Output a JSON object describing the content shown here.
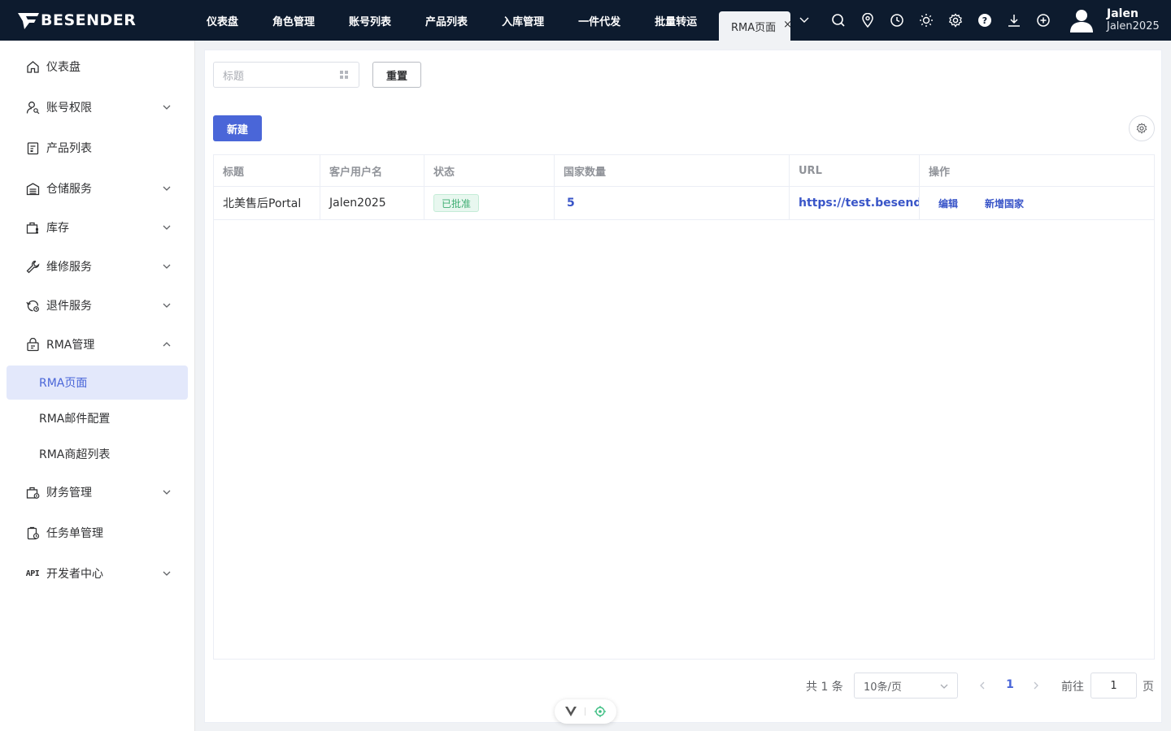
{
  "brand": {
    "name": "BESENDER"
  },
  "topnav": {
    "items": [
      "仪表盘",
      "角色管理",
      "账号列表",
      "产品列表",
      "入库管理",
      "一件代发",
      "批量转运"
    ],
    "active_tab": "RMA页面",
    "close_glyph": "×"
  },
  "user": {
    "name": "Jalen",
    "account": "Jalen2025"
  },
  "sidebar": {
    "items": [
      {
        "label": "仪表盘",
        "icon": "home-icon"
      },
      {
        "label": "账号权限",
        "icon": "user-key-icon"
      },
      {
        "label": "产品列表",
        "icon": "product-icon"
      },
      {
        "label": "仓储服务",
        "icon": "warehouse-icon"
      },
      {
        "label": "库存",
        "icon": "inventory-icon"
      },
      {
        "label": "维修服务",
        "icon": "wrench-icon"
      },
      {
        "label": "退件服务",
        "icon": "return-icon"
      },
      {
        "label": "RMA管理",
        "icon": "rma-icon"
      },
      {
        "label": "财务管理",
        "icon": "finance-icon"
      },
      {
        "label": "任务单管理",
        "icon": "task-icon"
      },
      {
        "label": "开发者中心",
        "icon": "api-icon",
        "icon_text": "API"
      }
    ],
    "rma_sub": [
      "RMA页面",
      "RMA邮件配置",
      "RMA商超列表"
    ]
  },
  "filters": {
    "title_placeholder": "标题",
    "reset_label": "重置"
  },
  "toolbar": {
    "new_label": "新建"
  },
  "table": {
    "columns": [
      "标题",
      "客户用户名",
      "状态",
      "国家数量",
      "URL",
      "操作"
    ],
    "rows": [
      {
        "title": "北美售后Portal",
        "username": "Jalen2025",
        "status": "已批准",
        "country_count": "5",
        "url": "https://test.besender.com",
        "actions": [
          "编辑",
          "新增国家"
        ]
      }
    ]
  },
  "pagination": {
    "total": "共 1 条",
    "page_size": "10条/页",
    "current_page": "1",
    "goto_label": "前往",
    "goto_value": "1",
    "page_suffix": "页"
  },
  "colors": {
    "primary": "#4a66d8",
    "topbar": "#0d1b2e",
    "success": "#3fae73"
  }
}
